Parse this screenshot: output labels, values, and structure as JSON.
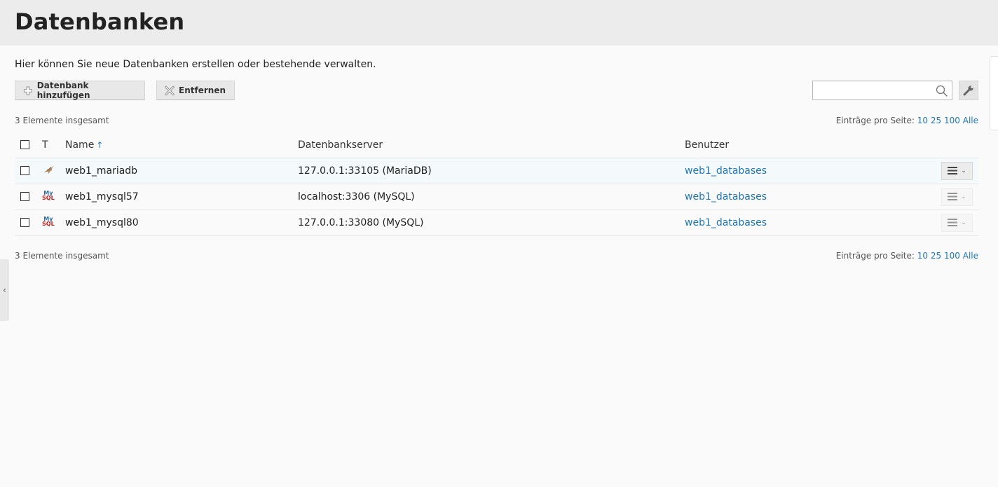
{
  "page": {
    "title": "Datenbanken",
    "description": "Hier können Sie neue Datenbanken erstellen oder bestehende verwalten."
  },
  "toolbar": {
    "add_label": "Datenbank hinzufügen",
    "remove_label": "Entfernen",
    "search_value": "",
    "search_placeholder": ""
  },
  "pagination": {
    "total_label": "3 Elemente insgesamt",
    "per_page_label": "Einträge pro Seite:",
    "options": [
      "10",
      "25",
      "100",
      "Alle"
    ]
  },
  "table": {
    "columns": {
      "type": "T",
      "name": "Name",
      "server": "Datenbankserver",
      "user": "Benutzer"
    },
    "sort_indicator": "↑",
    "rows": [
      {
        "type_icon": "mariadb-seal-icon",
        "name": "web1_mariadb",
        "server": "127.0.0.1:33105 (MariaDB)",
        "user": "web1_databases"
      },
      {
        "type_icon": "mysql-logo-icon",
        "name": "web1_mysql57",
        "server": "localhost:3306 (MySQL)",
        "user": "web1_databases"
      },
      {
        "type_icon": "mysql-logo-icon",
        "name": "web1_mysql80",
        "server": "127.0.0.1:33080 (MySQL)",
        "user": "web1_databases"
      }
    ]
  },
  "colors": {
    "link": "#1f76b3",
    "header_bg": "#ececec",
    "page_bg": "#fafafa"
  },
  "icons": {
    "add": "plus-icon",
    "remove": "x-icon",
    "search": "search-icon",
    "tools": "wrench-icon",
    "row_menu": "hamburger-menu-icon",
    "sidebar_toggle": "chevron-left-icon"
  }
}
